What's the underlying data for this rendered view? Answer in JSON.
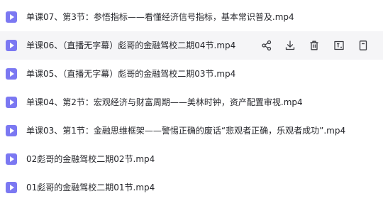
{
  "files": [
    {
      "name": "单课07、第3节：参悟指标——看懂经济信号指标，基本常识普及.mp4"
    },
    {
      "name": "单课06、（直播无字幕）彪哥的金融驾校二期04节.mp4"
    },
    {
      "name": "单课05、（直播无字幕）彪哥的金融驾校二期03节.mp4"
    },
    {
      "name": "单课04、第2节：宏观经济与财富周期——美林时钟，资产配置审视.mp4"
    },
    {
      "name": "单课03、第1节：金融思维框架——警惕正确的废话“悲观者正确，乐观者成功”.mp4"
    },
    {
      "name": "02彪哥的金融驾校二期02节.mp4"
    },
    {
      "name": "01彪哥的金融驾校二期01节.mp4"
    }
  ],
  "hover_actions": [
    "share-icon",
    "download-icon",
    "delete-icon",
    "rename-icon",
    "more-icon"
  ],
  "colors": {
    "video_icon": "#7b78f2",
    "hover_bg": "#f5f5f7",
    "text": "#25262b",
    "action_icon": "#3a3b40"
  }
}
